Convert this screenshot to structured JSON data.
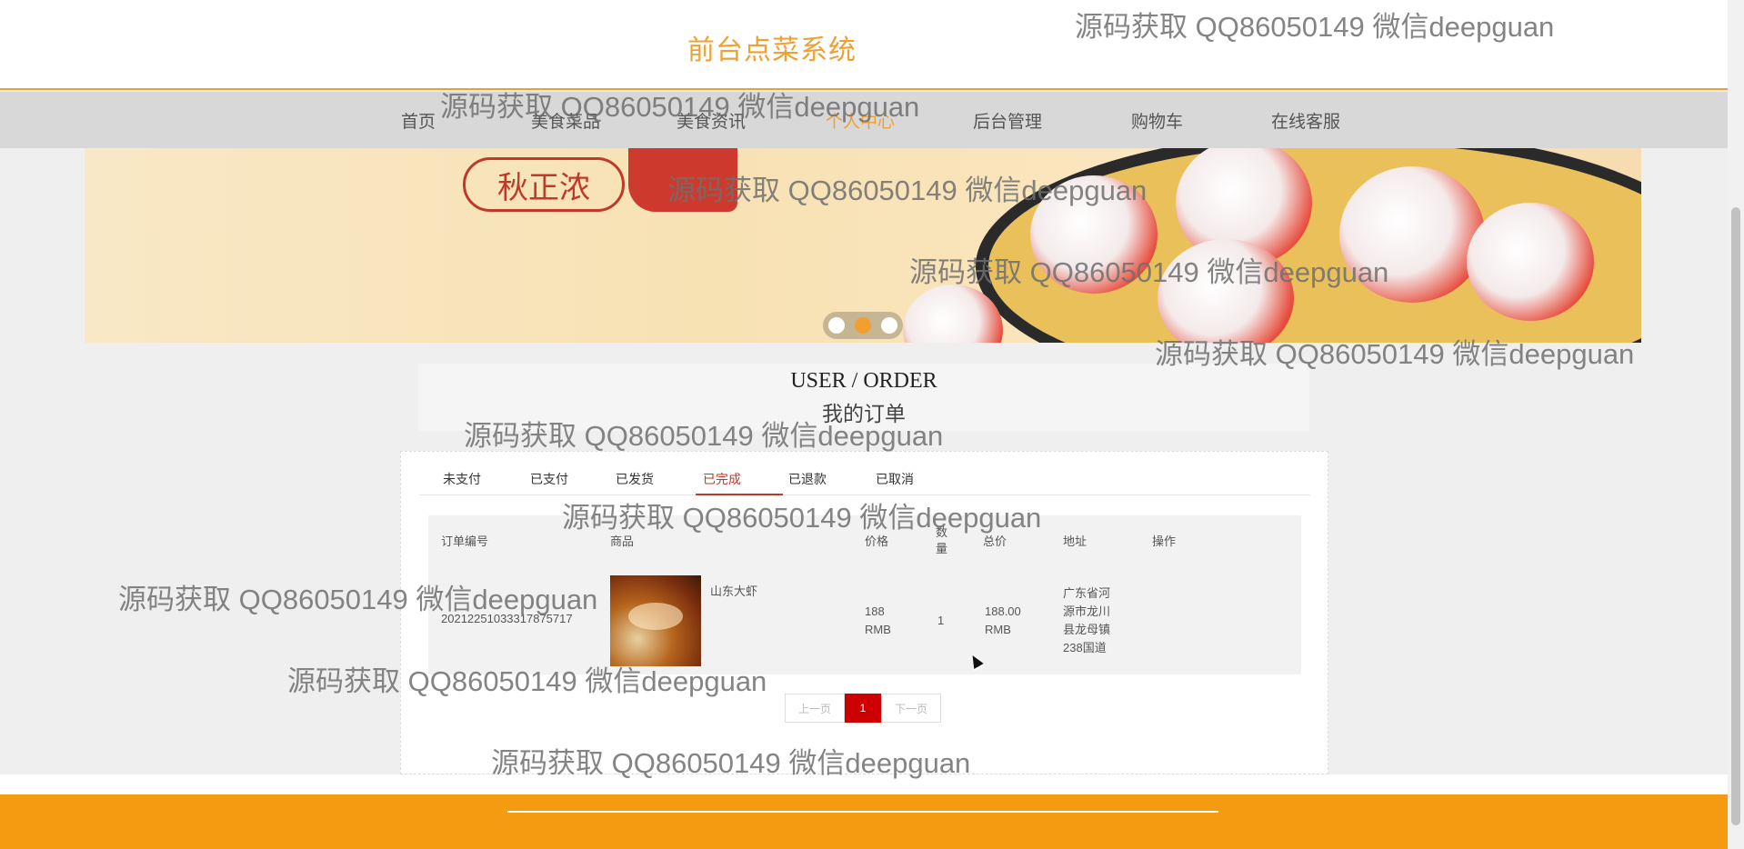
{
  "header": {
    "site_title": "前台点菜系统"
  },
  "nav": {
    "items": [
      "首页",
      "美食菜品",
      "美食资讯",
      "个人中心",
      "后台管理",
      "购物车",
      "在线客服"
    ],
    "active_index": 3
  },
  "banner": {
    "stamp_text": "秋正浓",
    "slide_count": 3,
    "active_slide": 2
  },
  "section": {
    "title_en": "USER / ORDER",
    "title_cn": "我的订单"
  },
  "tabs": {
    "items": [
      "未支付",
      "已支付",
      "已发货",
      "已完成",
      "已退款",
      "已取消"
    ],
    "active_index": 3
  },
  "table": {
    "headers": [
      "订单编号",
      "商品",
      "价格",
      "数量",
      "总价",
      "地址",
      "操作"
    ],
    "rows": [
      {
        "order_no": "20212251033317875717",
        "product": "山东大虾",
        "price": "188 RMB",
        "quantity": "1",
        "total": "188.00 RMB",
        "address": "广东省河源市龙川县龙母镇238国道"
      }
    ]
  },
  "pagination": {
    "prev": "上一页",
    "current": "1",
    "next": "下一页"
  },
  "watermark": "源码获取 QQ86050149 微信deepguan",
  "colors": {
    "brand_orange": "#f0a030",
    "footer_orange": "#f59b12",
    "active_red": "#c0392b",
    "page_red": "#cc0000"
  }
}
